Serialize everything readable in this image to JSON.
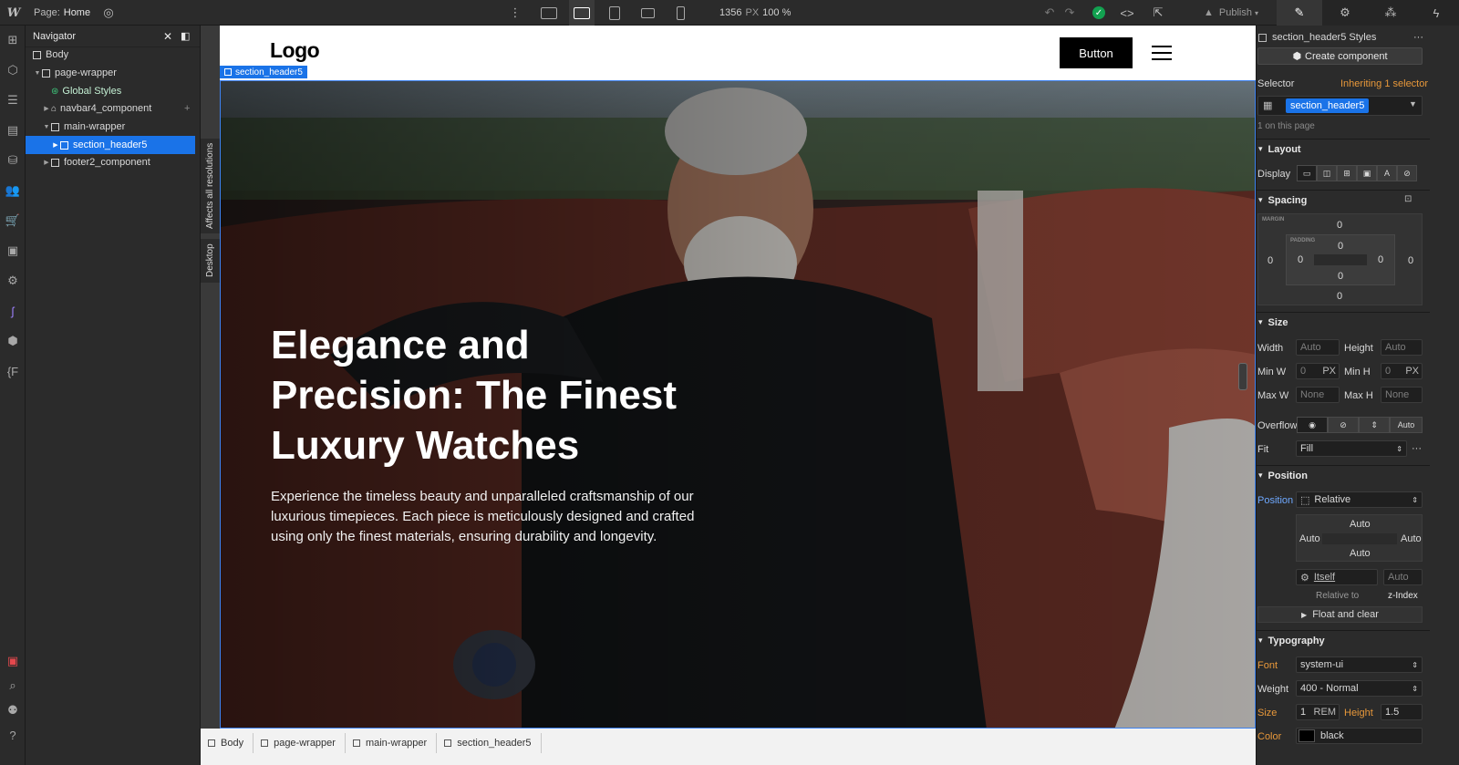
{
  "topbar": {
    "page_prefix": "Page:",
    "page_name": "Home",
    "viewport_width": "1356",
    "viewport_unit": "PX",
    "zoom": "100 %",
    "publish_label": "Publish"
  },
  "navigator": {
    "title": "Navigator",
    "items": [
      {
        "label": "Body"
      },
      {
        "label": "page-wrapper"
      },
      {
        "label": "Global Styles"
      },
      {
        "label": "navbar4_component"
      },
      {
        "label": "main-wrapper"
      },
      {
        "label": "section_header5"
      },
      {
        "label": "footer2_component"
      }
    ]
  },
  "side_tabs": {
    "affects": "Affects all resolutions",
    "desktop": "Desktop"
  },
  "canvas": {
    "logo": "Logo",
    "button": "Button",
    "selected_tag": "section_header5",
    "hero_title": "Elegance and Precision: The Finest Luxury Watches",
    "hero_text": "Experience the timeless beauty and unparalleled craftsmanship of our luxurious timepieces. Each piece is meticulously designed and crafted using only the finest materials, ensuring durability and longevity."
  },
  "breadcrumb": [
    "Body",
    "page-wrapper",
    "main-wrapper",
    "section_header5"
  ],
  "style_panel": {
    "styles_title": "section_header5 Styles",
    "create_component": "Create component",
    "selector_label": "Selector",
    "inheriting_prefix": "Inheriting",
    "inheriting_link": "1 selector",
    "selector_chip": "section_header5",
    "on_page": "1 on this page",
    "layout": {
      "title": "Layout",
      "display_label": "Display"
    },
    "spacing": {
      "title": "Spacing",
      "margin_label": "MARGIN",
      "padding_label": "PADDING",
      "m_top": "0",
      "m_left": "0",
      "m_right": "0",
      "m_bottom": "0",
      "p_top": "0",
      "p_left": "0",
      "p_right": "0",
      "p_bottom": "0"
    },
    "size": {
      "title": "Size",
      "width_label": "Width",
      "width_val": "Auto",
      "height_label": "Height",
      "height_val": "Auto",
      "minw_label": "Min W",
      "minw_val": "0",
      "minw_unit": "PX",
      "minh_label": "Min H",
      "minh_val": "0",
      "minh_unit": "PX",
      "maxw_label": "Max W",
      "maxw_val": "None",
      "maxh_label": "Max H",
      "maxh_val": "None",
      "overflow_label": "Overflow",
      "overflow_auto": "Auto",
      "fit_label": "Fit",
      "fit_val": "Fill"
    },
    "position": {
      "title": "Position",
      "label": "Position",
      "value": "Relative",
      "top": "Auto",
      "left": "Auto",
      "right": "Auto",
      "bottom": "Auto",
      "itself": "Itself",
      "relative_to": "Relative to",
      "zindex_val": "Auto",
      "zindex_label": "z-Index",
      "float": "Float and clear"
    },
    "typography": {
      "title": "Typography",
      "font_label": "Font",
      "font_val": "system-ui",
      "weight_label": "Weight",
      "weight_val": "400 - Normal",
      "size_label": "Size",
      "size_val": "1",
      "size_unit": "REM",
      "height_label": "Height",
      "height_val": "1.5",
      "color_label": "Color",
      "color_val": "black"
    }
  },
  "colors": {
    "accent": "#1a73e8",
    "panel": "#2b2b2b",
    "orange": "#e8983a"
  }
}
